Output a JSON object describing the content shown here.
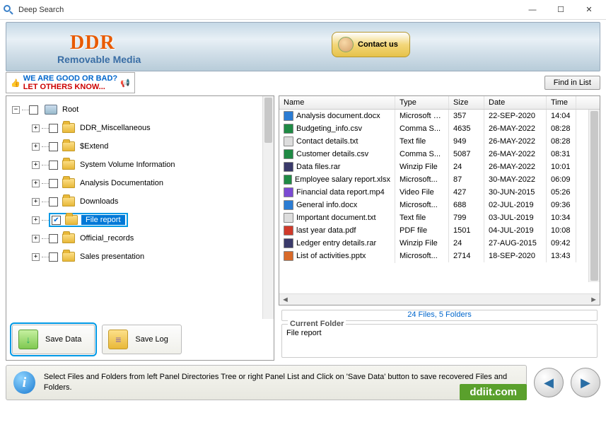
{
  "window": {
    "title": "Deep Search"
  },
  "banner": {
    "brand": "DDR",
    "subtitle": "Removable Media",
    "contact_label": "Contact us"
  },
  "feedback": {
    "line1": "WE ARE GOOD OR BAD?",
    "line2": "LET OTHERS KNOW..."
  },
  "find_button": "Find in List",
  "tree": {
    "root": "Root",
    "items": [
      "DDR_Miscellaneous",
      "$Extend",
      "System Volume Information",
      "Analysis Documentation",
      "Downloads",
      "File report",
      "Official_records",
      "Sales presentation"
    ],
    "selected_index": 5
  },
  "buttons": {
    "save_data": "Save Data",
    "save_log": "Save Log"
  },
  "columns": {
    "name": "Name",
    "type": "Type",
    "size": "Size",
    "date": "Date",
    "time": "Time"
  },
  "files": [
    {
      "ic": "docx",
      "name": "Analysis document.docx",
      "type": "Microsoft S...",
      "size": "357",
      "date": "22-SEP-2020",
      "time": "14:04"
    },
    {
      "ic": "csv",
      "name": "Budgeting_info.csv",
      "type": "Comma S...",
      "size": "4635",
      "date": "26-MAY-2022",
      "time": "08:28"
    },
    {
      "ic": "txt",
      "name": "Contact details.txt",
      "type": "Text file",
      "size": "949",
      "date": "26-MAY-2022",
      "time": "08:28"
    },
    {
      "ic": "csv",
      "name": "Customer details.csv",
      "type": "Comma S...",
      "size": "5087",
      "date": "26-MAY-2022",
      "time": "08:31"
    },
    {
      "ic": "rar",
      "name": "Data files.rar",
      "type": "Winzip File",
      "size": "24",
      "date": "26-MAY-2022",
      "time": "10:01"
    },
    {
      "ic": "xlsx",
      "name": "Employee salary report.xlsx",
      "type": "Microsoft...",
      "size": "87",
      "date": "30-MAY-2022",
      "time": "06:09"
    },
    {
      "ic": "mp4",
      "name": "Financial data report.mp4",
      "type": "Video File",
      "size": "427",
      "date": "30-JUN-2015",
      "time": "05:26"
    },
    {
      "ic": "docx",
      "name": "General info.docx",
      "type": "Microsoft...",
      "size": "688",
      "date": "02-JUL-2019",
      "time": "09:36"
    },
    {
      "ic": "txt",
      "name": "Important document.txt",
      "type": "Text file",
      "size": "799",
      "date": "03-JUL-2019",
      "time": "10:34"
    },
    {
      "ic": "pdf",
      "name": "last year data.pdf",
      "type": "PDF file",
      "size": "1501",
      "date": "04-JUL-2019",
      "time": "10:08"
    },
    {
      "ic": "rar",
      "name": "Ledger entry details.rar",
      "type": "Winzip File",
      "size": "24",
      "date": "27-AUG-2015",
      "time": "09:42"
    },
    {
      "ic": "pptx",
      "name": "List of activities.pptx",
      "type": "Microsoft...",
      "size": "2714",
      "date": "18-SEP-2020",
      "time": "13:43"
    }
  ],
  "summary": "24 Files, 5 Folders",
  "current_folder": {
    "legend": "Current Folder",
    "value": "File report"
  },
  "hint": "Select Files and Folders from left Panel Directories Tree or right Panel List and Click on 'Save Data' button to save recovered Files and Folders.",
  "brand_tag": "ddiit.com"
}
